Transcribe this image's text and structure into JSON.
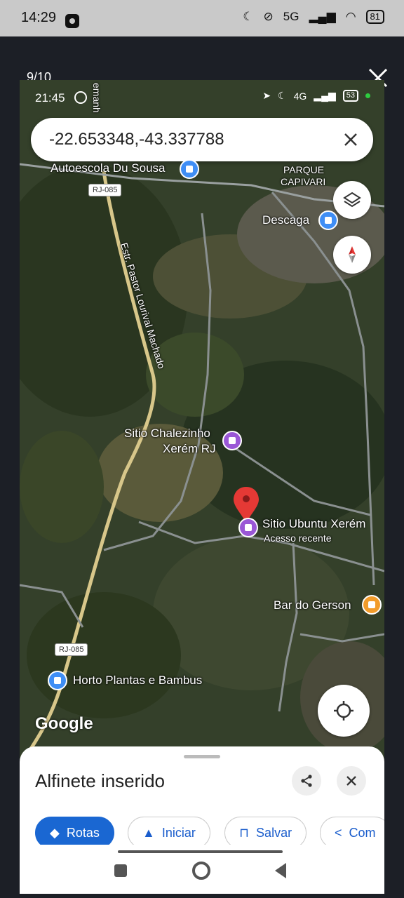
{
  "outer_status": {
    "time": "14:29",
    "network": "5G",
    "battery": "81"
  },
  "viewer": {
    "counter": "9/10"
  },
  "inner_status": {
    "time": "21:45",
    "network": "4G",
    "battery": "53"
  },
  "search": {
    "value": "-22.653348,-43.337788"
  },
  "map": {
    "labels": {
      "autoescola": "Autoescola Du Sousa",
      "parque_line1": "PARQUE",
      "parque_line2": "CAPIVARI",
      "descaga": "Descaga",
      "estrada": "Estr. Pastor Lourival Machado",
      "estrada_top": "emanh",
      "chalezinho_line1": "Sitio Chalezinho",
      "chalezinho_line2": "Xerém RJ",
      "ubuntu": "Sitio Ubuntu Xerém",
      "ubuntu_sub": "Acesso recente",
      "bar_gerson": "Bar do Gerson",
      "horto": "Horto Plantas e Bambus",
      "google": "Google"
    },
    "road_shields": {
      "top": "RJ-085",
      "bottom": "RJ-085"
    },
    "colors": {
      "poi_purple": "#9a57d6",
      "poi_orange": "#f29c2b",
      "poi_blue": "#3f8ef5",
      "pin_red": "#e53935"
    }
  },
  "sheet": {
    "title": "Alfinete inserido",
    "chips": [
      "Rotas",
      "Iniciar",
      "Salvar",
      "Com"
    ]
  }
}
